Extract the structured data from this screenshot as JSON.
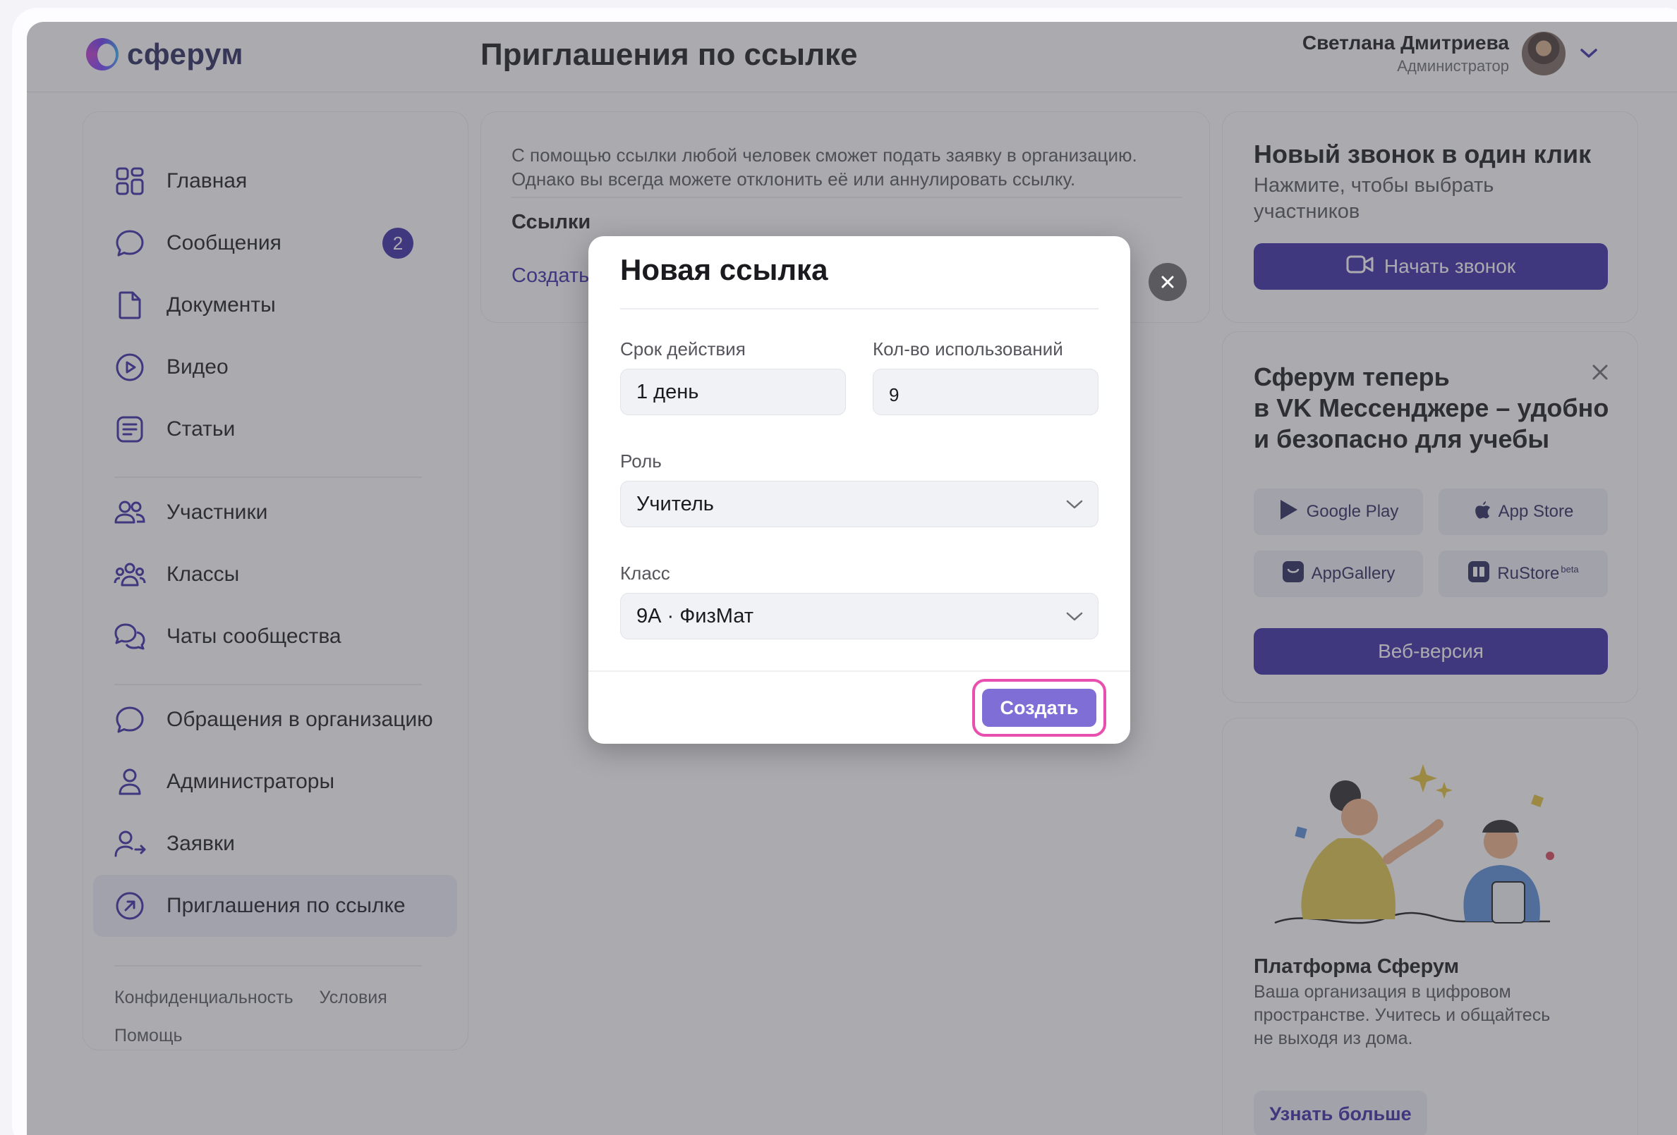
{
  "header": {
    "logo_text": "сферум",
    "page_title": "Приглашения по ссылке",
    "user_name": "Светлана Дмитриева",
    "user_role": "Администратор"
  },
  "sidebar": {
    "items": [
      {
        "label": "Главная",
        "icon": "home-grid-icon"
      },
      {
        "label": "Сообщения",
        "icon": "message-icon",
        "badge": "2"
      },
      {
        "label": "Документы",
        "icon": "document-icon"
      },
      {
        "label": "Видео",
        "icon": "video-play-icon"
      },
      {
        "label": "Статьи",
        "icon": "article-icon"
      },
      {
        "label": "Участники",
        "icon": "members-icon"
      },
      {
        "label": "Классы",
        "icon": "classes-icon"
      },
      {
        "label": "Чаты сообщества",
        "icon": "community-chats-icon"
      },
      {
        "label": "Обращения в организацию",
        "icon": "appeal-icon"
      },
      {
        "label": "Администраторы",
        "icon": "admin-icon"
      },
      {
        "label": "Заявки",
        "icon": "requests-icon"
      },
      {
        "label": "Приглашения по ссылке",
        "icon": "invite-link-icon"
      }
    ],
    "footer": {
      "privacy": "Конфиденциальность",
      "terms": "Условия",
      "help": "Помощь"
    }
  },
  "main": {
    "description_line1": "С помощью ссылки любой человек сможет подать заявку в организацию.",
    "description_line2": "Однако вы всегда можете отклонить её или аннулировать ссылку.",
    "links_title": "Ссылки",
    "create_link": "Создать"
  },
  "right": {
    "call_card": {
      "title": "Новый звонок в один клик",
      "subtitle_line1": "Нажмите, чтобы выбрать",
      "subtitle_line2": "участников",
      "button": "Начать звонок"
    },
    "messenger_card": {
      "title_line1": "Сферум теперь",
      "title_line2": "в VK Мессенджере – удобно",
      "title_line3": "и безопасно для учебы",
      "stores": [
        "Google Play",
        "App Store",
        "AppGallery",
        "RuStore"
      ],
      "rustore_sup": "beta",
      "web_button": "Веб-версия"
    },
    "platform_card": {
      "title": "Платформа Сферум",
      "text_line1": "Ваша организация в цифровом",
      "text_line2": "пространстве. Учитесь и общайтесь",
      "text_line3": "не выходя из дома.",
      "button": "Узнать больше"
    }
  },
  "modal": {
    "title": "Новая ссылка",
    "duration_label": "Срок  действия",
    "duration_value": "1 день",
    "uses_label": "Кол-во использований",
    "uses_value": "9",
    "role_label": "Роль",
    "role_value": "Учитель",
    "class_label": "Класс",
    "class_value": "9А · ФизМат",
    "create_button": "Создать"
  },
  "colors": {
    "accent": "#3b2ea6",
    "highlight": "#e84fae",
    "create_button": "#7f6ed6"
  }
}
